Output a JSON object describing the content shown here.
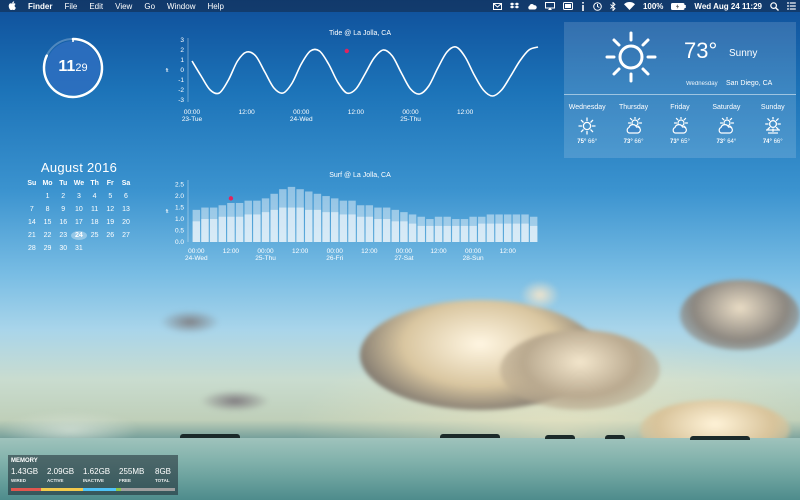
{
  "menubar": {
    "apple_icon": "apple-icon",
    "app_name": "Finder",
    "menus": [
      "File",
      "Edit",
      "View",
      "Go",
      "Window",
      "Help"
    ],
    "status_icons": [
      "gmail-icon",
      "dropbox-icon",
      "cloud-icon",
      "airplay-icon",
      "battery-widget-icon",
      "info-icon",
      "time-machine-icon",
      "bluetooth-icon",
      "wifi-icon"
    ],
    "battery_percent": "100%",
    "datetime": "Wed Aug 24  11:29",
    "search_icon": "spotlight-icon",
    "list_icon": "notification-center-icon"
  },
  "clock": {
    "hour": "11",
    "minute": "29",
    "progress": 0.82
  },
  "calendar": {
    "month_title": "August 2016",
    "weekdays": [
      "Su",
      "Mo",
      "Tu",
      "We",
      "Th",
      "Fr",
      "Sa"
    ],
    "days": [
      "",
      "1",
      "2",
      "3",
      "4",
      "5",
      "6",
      "7",
      "8",
      "9",
      "10",
      "11",
      "12",
      "13",
      "14",
      "15",
      "16",
      "17",
      "18",
      "19",
      "20",
      "21",
      "22",
      "23",
      "24",
      "25",
      "26",
      "27",
      "28",
      "29",
      "30",
      "31"
    ],
    "today": "24"
  },
  "chart_data": [
    {
      "type": "line",
      "title": "Tide @ La Jolla, CA",
      "ylabel": "ft",
      "yticks": [
        -3,
        -2,
        -1,
        0,
        1,
        2,
        3
      ],
      "ylim": [
        -3.2,
        3.2
      ],
      "xlim": [
        0,
        76
      ],
      "xticks": [
        {
          "h": 0,
          "time": "00:00",
          "date": "23-Tue"
        },
        {
          "h": 12,
          "time": "12:00",
          "date": ""
        },
        {
          "h": 24,
          "time": "00:00",
          "date": "24-Wed"
        },
        {
          "h": 36,
          "time": "12:00",
          "date": ""
        },
        {
          "h": 48,
          "time": "00:00",
          "date": "25-Thu"
        },
        {
          "h": 60,
          "time": "12:00",
          "date": ""
        }
      ],
      "x": [
        0,
        2,
        4,
        6,
        8,
        10,
        12,
        14,
        16,
        18,
        20,
        22,
        24,
        26,
        28,
        30,
        32,
        34,
        36,
        38,
        40,
        42,
        44,
        46,
        48,
        50,
        52,
        54,
        56,
        58,
        60,
        62,
        64,
        66,
        68,
        70,
        72,
        74,
        76
      ],
      "y": [
        0.9,
        -0.6,
        -2.0,
        -2.3,
        -1.0,
        0.9,
        1.8,
        1.4,
        -0.2,
        -1.8,
        -2.3,
        -1.3,
        0.6,
        1.9,
        1.9,
        0.6,
        -1.2,
        -2.3,
        -1.9,
        -0.4,
        1.2,
        2.0,
        1.4,
        -0.3,
        -1.9,
        -2.4,
        -1.6,
        0.2,
        1.8,
        2.3,
        1.3,
        -0.5,
        -2.0,
        -2.6,
        -2.0,
        -0.6,
        0.9,
        2.0,
        2.3
      ],
      "current": {
        "x": 34,
        "y": 1.9
      }
    },
    {
      "type": "bar",
      "title": "Surf @ La Jolla, CA",
      "ylabel": "ft",
      "yticks": [
        0.0,
        0.5,
        1.0,
        1.5,
        2.0,
        2.5
      ],
      "ylim": [
        0,
        2.7
      ],
      "xticks": [
        {
          "i": 0,
          "time": "00:00",
          "date": "24-Wed"
        },
        {
          "i": 4,
          "time": "12:00",
          "date": ""
        },
        {
          "i": 8,
          "time": "00:00",
          "date": "25-Thu"
        },
        {
          "i": 12,
          "time": "12:00",
          "date": ""
        },
        {
          "i": 16,
          "time": "00:00",
          "date": "26-Fri"
        },
        {
          "i": 20,
          "time": "12:00",
          "date": ""
        },
        {
          "i": 24,
          "time": "00:00",
          "date": "27-Sat"
        },
        {
          "i": 28,
          "time": "12:00",
          "date": ""
        },
        {
          "i": 32,
          "time": "00:00",
          "date": "28-Sun"
        },
        {
          "i": 36,
          "time": "12:00",
          "date": ""
        }
      ],
      "series": [
        {
          "name": "max",
          "values": [
            1.4,
            1.5,
            1.5,
            1.6,
            1.7,
            1.7,
            1.8,
            1.8,
            1.9,
            2.1,
            2.3,
            2.4,
            2.3,
            2.2,
            2.1,
            2.0,
            1.9,
            1.8,
            1.8,
            1.6,
            1.6,
            1.5,
            1.5,
            1.4,
            1.3,
            1.2,
            1.1,
            1.0,
            1.1,
            1.1,
            1.0,
            1.0,
            1.1,
            1.1,
            1.2,
            1.2,
            1.2,
            1.2,
            1.2,
            1.1
          ]
        },
        {
          "name": "min",
          "values": [
            0.9,
            1.0,
            1.0,
            1.1,
            1.1,
            1.1,
            1.2,
            1.2,
            1.3,
            1.4,
            1.5,
            1.5,
            1.5,
            1.4,
            1.4,
            1.3,
            1.3,
            1.2,
            1.2,
            1.1,
            1.1,
            1.0,
            1.0,
            0.9,
            0.9,
            0.8,
            0.7,
            0.7,
            0.7,
            0.7,
            0.7,
            0.7,
            0.7,
            0.8,
            0.8,
            0.8,
            0.8,
            0.8,
            0.8,
            0.7
          ]
        }
      ],
      "current": {
        "i": 4,
        "y": 1.9
      }
    }
  ],
  "weather": {
    "temperature": "73°",
    "condition": "Sunny",
    "day": "Wednesday",
    "location": "San Diego, CA",
    "icon": "sun-icon",
    "forecast": [
      {
        "day": "Wednesday",
        "icon": "sun-icon",
        "hi": "75°",
        "lo": "66°"
      },
      {
        "day": "Thursday",
        "icon": "partly-cloudy-icon",
        "hi": "73°",
        "lo": "66°"
      },
      {
        "day": "Friday",
        "icon": "partly-cloudy-icon",
        "hi": "73°",
        "lo": "65°"
      },
      {
        "day": "Saturday",
        "icon": "partly-cloudy-icon",
        "hi": "73°",
        "lo": "64°"
      },
      {
        "day": "Sunday",
        "icon": "hazy-sun-icon",
        "hi": "74°",
        "lo": "66°"
      }
    ]
  },
  "memory": {
    "title": "MEMORY",
    "stats": [
      {
        "value": "1.43GB",
        "label": "WIRED",
        "color": "#e0564f",
        "fraction": 0.18
      },
      {
        "value": "2.09GB",
        "label": "ACTIVE",
        "color": "#f2c94c",
        "fraction": 0.26
      },
      {
        "value": "1.62GB",
        "label": "INACTIVE",
        "color": "#4fc3f7",
        "fraction": 0.2
      },
      {
        "value": "255MB",
        "label": "FREE",
        "color": "#8bc34a",
        "fraction": 0.03
      },
      {
        "value": "8GB",
        "label": "TOTAL",
        "color": "#9e9e9e",
        "fraction": 0.33
      }
    ]
  }
}
